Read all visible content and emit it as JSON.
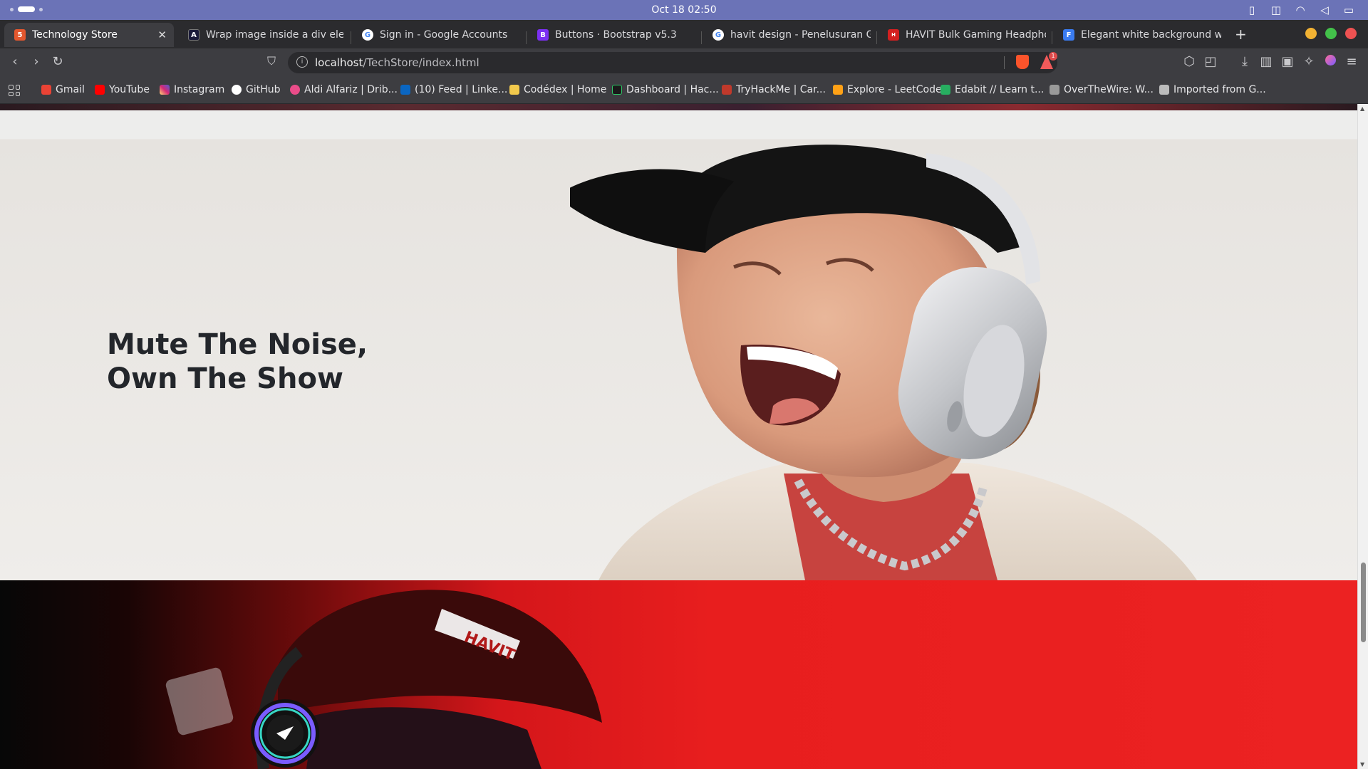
{
  "os": {
    "clock": "Oct 18  02:50",
    "tray_icons": [
      "clipboard-icon",
      "screen-icon",
      "wifi-icon",
      "volume-icon",
      "battery-icon"
    ]
  },
  "tabs": [
    {
      "title": "Technology Store",
      "active": true,
      "favicon": "html5-icon",
      "color": "#e4572e"
    },
    {
      "title": "Wrap image inside a div elemen",
      "active": false,
      "favicon": "astro-icon",
      "color": "#1b1b3a"
    },
    {
      "title": "Sign in - Google Accounts",
      "active": false,
      "favicon": "google-icon",
      "color": "#ffffff"
    },
    {
      "title": "Buttons · Bootstrap v5.3",
      "active": false,
      "favicon": "bootstrap-icon",
      "color": "#7b2ff2"
    },
    {
      "title": "havit design - Penelusuran Goo",
      "active": false,
      "favicon": "google-icon",
      "color": "#ffffff"
    },
    {
      "title": "HAVIT Bulk Gaming Headphone",
      "active": false,
      "favicon": "havit-icon",
      "color": "#d32020"
    },
    {
      "title": "Elegant white background with",
      "active": false,
      "favicon": "docs-icon",
      "color": "#3a7bf0"
    }
  ],
  "toolbar": {
    "url_host": "localhost",
    "url_path": "/TechStore/index.html",
    "shield_badge": "1"
  },
  "bookmarks": [
    {
      "label": "Gmail",
      "color": "#ea4335"
    },
    {
      "label": "YouTube",
      "color": "#ff0000"
    },
    {
      "label": "Instagram",
      "color": "#d62976"
    },
    {
      "label": "GitHub",
      "color": "#ffffff"
    },
    {
      "label": "Aldi Alfariz | Drib...",
      "color": "#ea4c89"
    },
    {
      "label": "(10) Feed | Linke...",
      "color": "#0a66c2"
    },
    {
      "label": "Codédex | Home",
      "color": "#f2c94c"
    },
    {
      "label": "Dashboard | Hac...",
      "color": "#1a1a1a"
    },
    {
      "label": "TryHackMe | Car...",
      "color": "#c0392b"
    },
    {
      "label": "Explore - LeetCode",
      "color": "#ffa116"
    },
    {
      "label": "Edabit // Learn t...",
      "color": "#27ae60"
    },
    {
      "label": "OverTheWire: W...",
      "color": "#999999"
    },
    {
      "label": "Imported from G...",
      "color": "#bbbbbb"
    }
  ],
  "page": {
    "hero_title_line1": "Mute The Noise,",
    "hero_title_line2": "Own The Show",
    "promo_brand": "HAVIT",
    "accent_red": "#e81e1e"
  }
}
